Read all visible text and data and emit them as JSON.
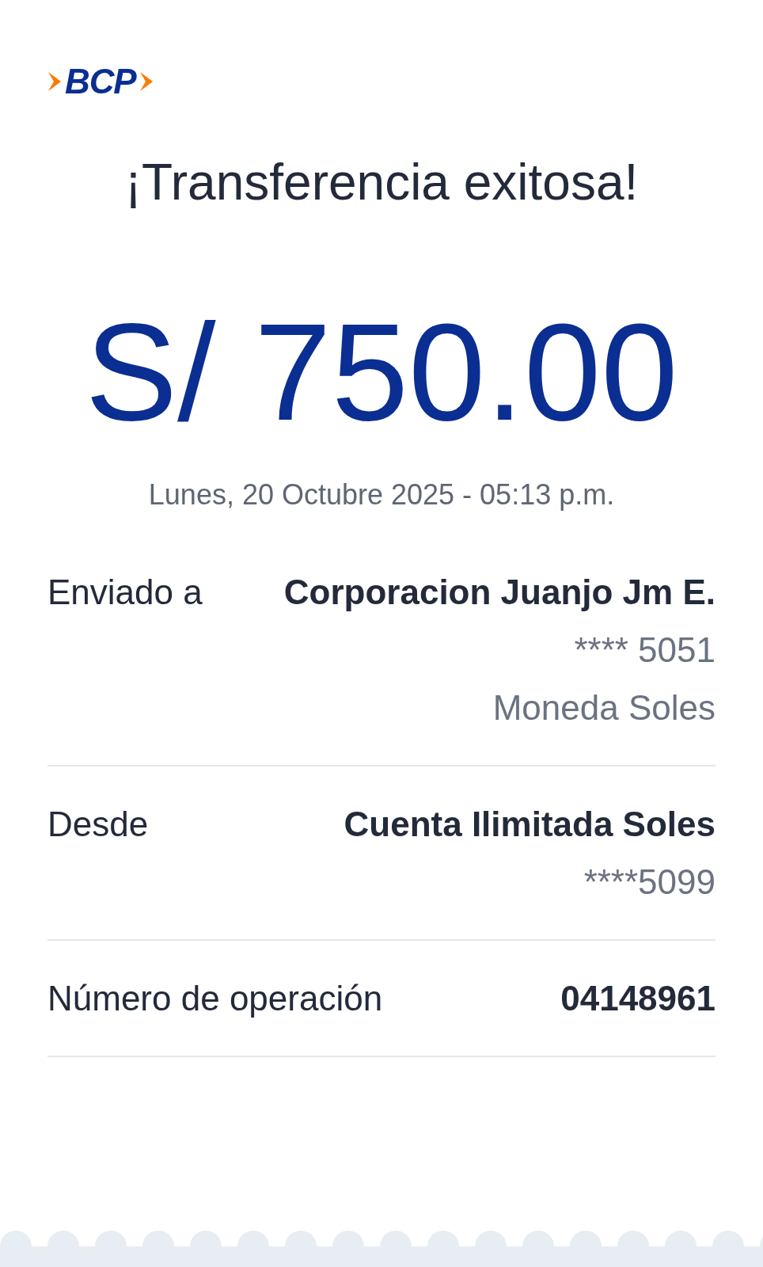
{
  "logo": {
    "text": "BCP"
  },
  "title": "¡Transferencia exitosa!",
  "amount": "S/ 750.00",
  "datetime": "Lunes, 20 Octubre 2025 - 05:13 p.m.",
  "details": [
    {
      "label": "Enviado a",
      "lines": [
        {
          "text": "Corporacion Juanjo Jm E.",
          "kind": "primary"
        },
        {
          "text": "**** 5051",
          "kind": "secondary"
        },
        {
          "text": "Moneda Soles",
          "kind": "secondary"
        }
      ]
    },
    {
      "label": "Desde",
      "lines": [
        {
          "text": "Cuenta Ilimitada Soles",
          "kind": "primary"
        },
        {
          "text": "****5099",
          "kind": "secondary"
        }
      ]
    },
    {
      "label": "Número de operación",
      "lines": [
        {
          "text": "04148961",
          "kind": "primary"
        }
      ]
    }
  ]
}
